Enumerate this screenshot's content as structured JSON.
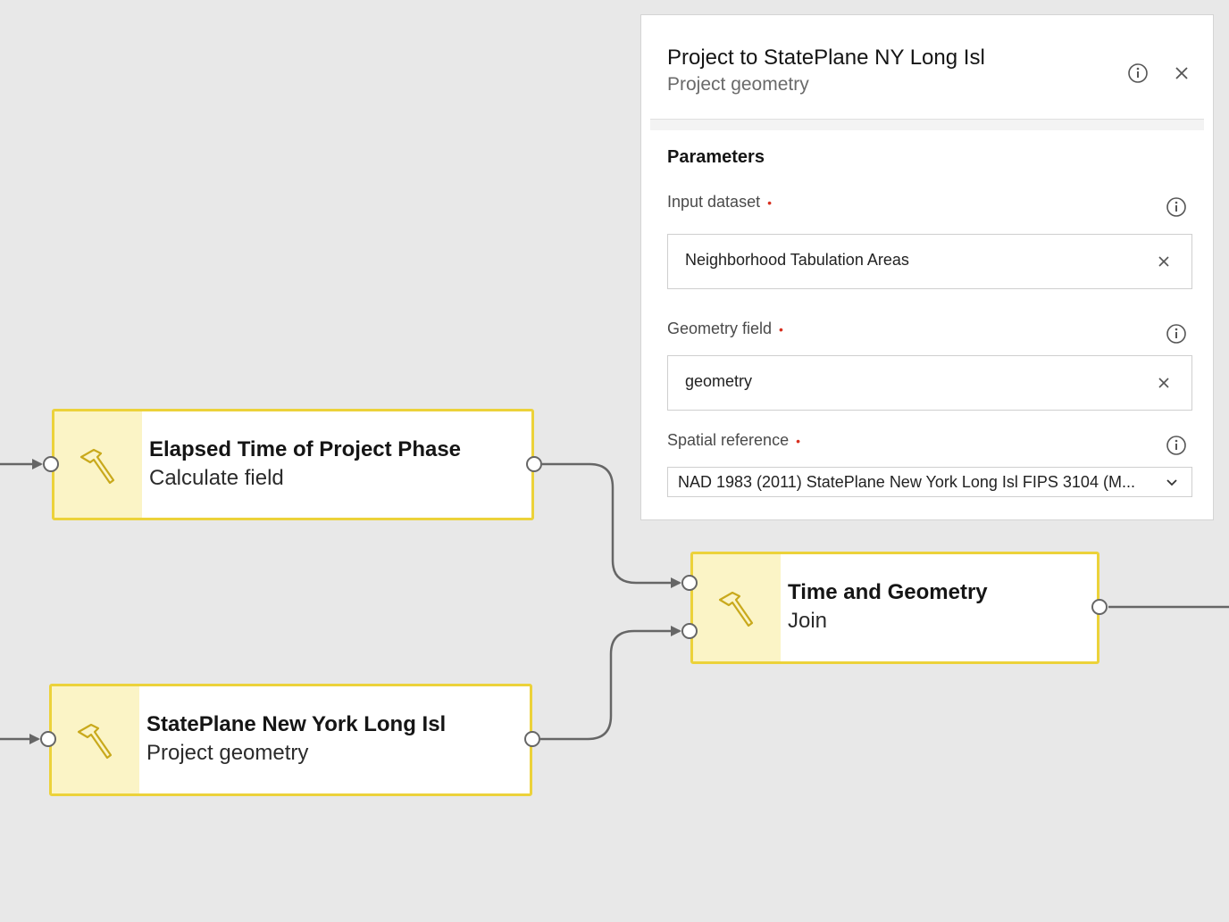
{
  "workflow": {
    "nodes": {
      "elapsed": {
        "title": "Elapsed Time of Project Phase",
        "subtitle": "Calculate field",
        "icon": "hammer-icon"
      },
      "stateplane": {
        "title": "StatePlane New York Long Isl",
        "subtitle": "Project geometry",
        "icon": "hammer-icon"
      },
      "join": {
        "title": "Time and Geometry",
        "subtitle": "Join",
        "icon": "hammer-icon"
      }
    }
  },
  "panel": {
    "title": "Project to StatePlane NY Long Isl",
    "subtitle": "Project geometry",
    "section_title": "Parameters",
    "fields": {
      "input_dataset": {
        "label": "Input dataset",
        "value": "Neighborhood Tabulation Areas"
      },
      "geometry_field": {
        "label": "Geometry field",
        "value": "geometry"
      },
      "spatial_reference": {
        "label": "Spatial reference",
        "value": "NAD 1983 (2011) StatePlane New York Long Isl FIPS 3104 (M..."
      }
    },
    "required_marker": "•"
  },
  "colors": {
    "node_border": "#ecd23a",
    "node_icon_bg": "#fbf4c6",
    "connector": "#666666",
    "required": "#d83020",
    "canvas_bg": "#e8e8e8"
  }
}
